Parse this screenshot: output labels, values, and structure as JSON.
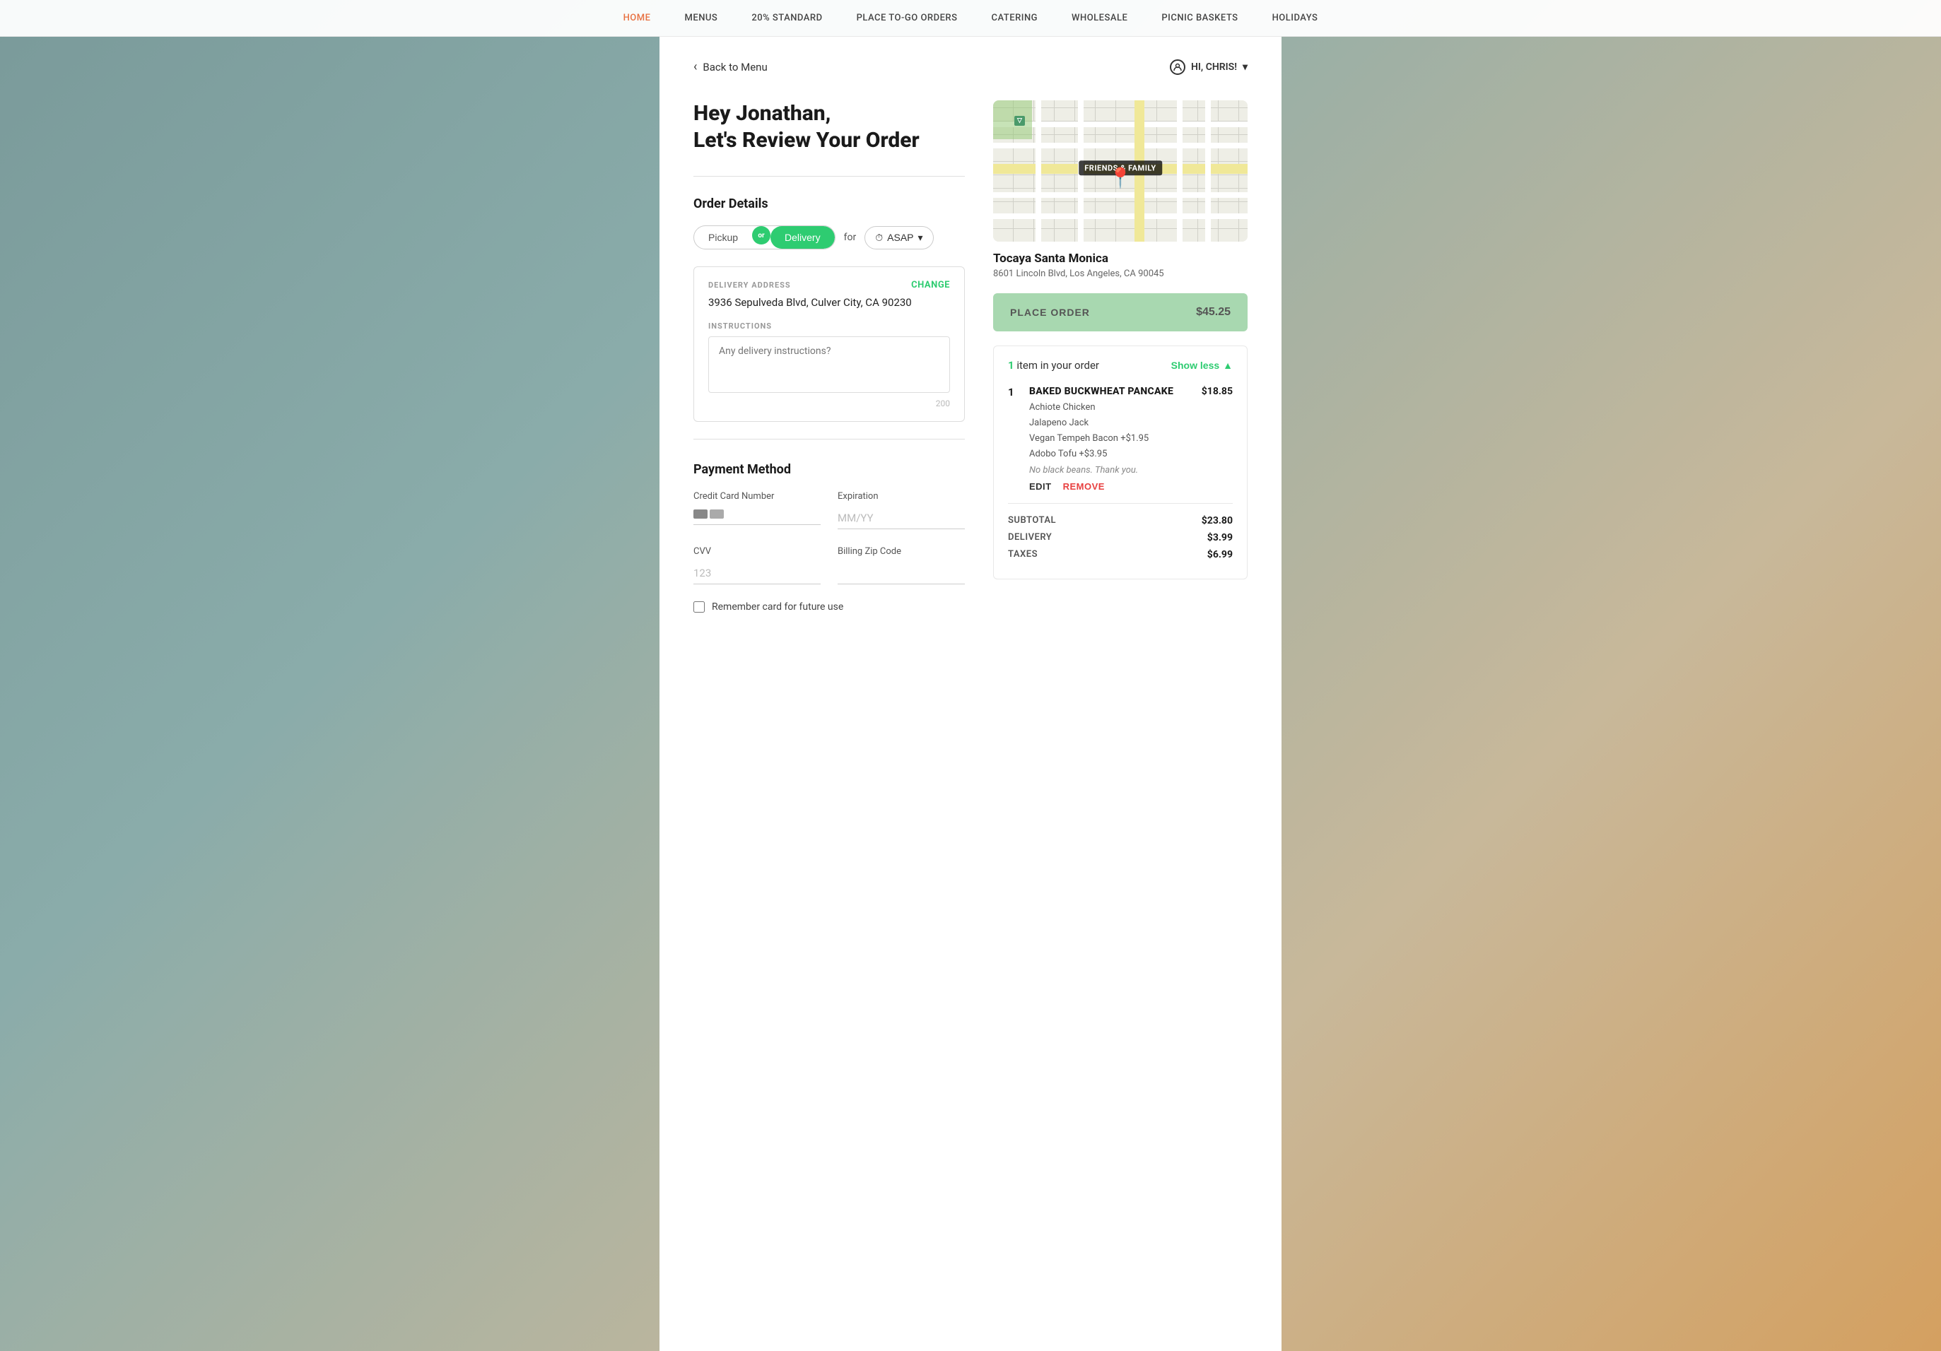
{
  "nav": {
    "items": [
      {
        "id": "home",
        "label": "HOME",
        "active": true
      },
      {
        "id": "menus",
        "label": "MENUS",
        "active": false
      },
      {
        "id": "standard",
        "label": "20% STANDARD",
        "active": false
      },
      {
        "id": "place-to-go",
        "label": "PLACE TO-GO ORDERS",
        "active": false
      },
      {
        "id": "catering",
        "label": "CATERING",
        "active": false
      },
      {
        "id": "wholesale",
        "label": "WHOLESALE",
        "active": false
      },
      {
        "id": "picnic",
        "label": "PICNIC BASKETS",
        "active": false
      },
      {
        "id": "holidays",
        "label": "HOLIDAYS",
        "active": false
      }
    ]
  },
  "header": {
    "back_label": "Back to Menu",
    "user_greeting": "HI, CHRIS!"
  },
  "page": {
    "title_line1": "Hey Jonathan,",
    "title_line2": "Let's Review Your Order"
  },
  "order_details": {
    "section_title": "Order Details",
    "pickup_label": "Pickup",
    "or_label": "or",
    "delivery_label": "Delivery",
    "for_label": "for",
    "asap_label": "ASAP",
    "delivery_address_label": "DELIVERY ADDRESS",
    "delivery_address_value": "3936 Sepulveda Blvd, Culver City, CA 90230",
    "change_label": "CHANGE",
    "instructions_label": "INSTRUCTIONS",
    "instructions_placeholder": "Any delivery instructions?",
    "char_limit": "200"
  },
  "payment": {
    "section_title": "Payment Method",
    "cc_label": "Credit Card Number",
    "cc_placeholder": "",
    "expiration_label": "Expiration",
    "expiration_placeholder": "MM/YY",
    "cvv_label": "CVV",
    "cvv_placeholder": "123",
    "zip_label": "Billing Zip Code",
    "zip_placeholder": "",
    "remember_label": "Remember card for future use"
  },
  "restaurant": {
    "name": "Tocaya Santa Monica",
    "address": "8601 Lincoln Blvd, Los Angeles, CA 90045",
    "map_label": "FRIENDS & FAMILY"
  },
  "place_order": {
    "label": "PLACE ORDER",
    "price": "$45.25"
  },
  "order_summary": {
    "item_count_prefix": "item",
    "item_count": "1",
    "item_count_suffix": " in your order",
    "show_less_label": "Show less",
    "items": [
      {
        "qty": "1",
        "name": "BAKED BUCKWHEAT PANCAKE",
        "price": "$18.85",
        "modifiers": [
          "Achiote Chicken",
          "Jalapeno Jack",
          "Vegan Tempeh Bacon +$1.95",
          "Adobo Tofu +$3.95"
        ],
        "note": "No black beans. Thank you.",
        "edit_label": "EDIT",
        "remove_label": "REMOVE"
      }
    ],
    "subtotal_label": "SUBTOTAL",
    "subtotal_value": "$23.80",
    "delivery_label": "DELIVERY",
    "delivery_value": "$3.99",
    "taxes_label": "TAXES",
    "taxes_value": "$6.99"
  }
}
